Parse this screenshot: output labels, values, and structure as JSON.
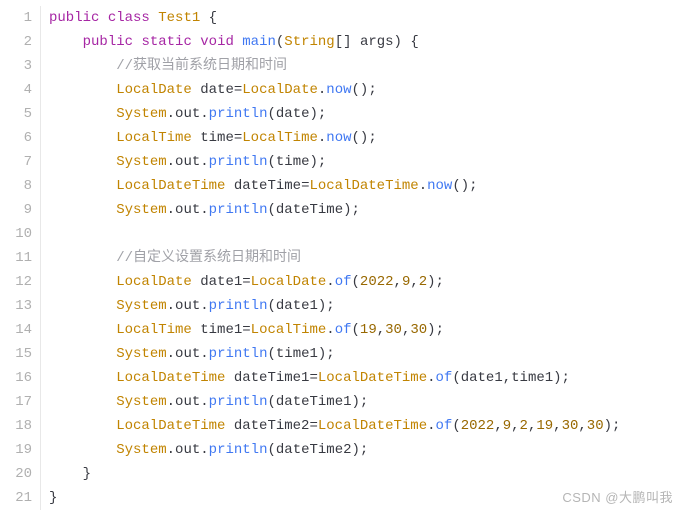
{
  "logical_content": {
    "description": "Java source code defining a class Test1 with a main method demonstrating java.time LocalDate/LocalTime/LocalDateTime usage.",
    "class_name": "Test1",
    "method": "public static void main(String[] args)",
    "comments": {
      "c1": "//获取当前系统日期和时间",
      "c2": "//自定义设置系统日期和时间"
    },
    "statements": [
      "LocalDate date=LocalDate.now();",
      "System.out.println(date);",
      "LocalTime time=LocalTime.now();",
      "System.out.println(time);",
      "LocalDateTime dateTime=LocalDateTime.now();",
      "System.out.println(dateTime);",
      "LocalDate date1=LocalDate.of(2022,9,2);",
      "System.out.println(date1);",
      "LocalTime time1=LocalTime.of(19,30,30);",
      "System.out.println(time1);",
      "LocalDateTime dateTime1=LocalDateTime.of(date1,time1);",
      "System.out.println(dateTime1);",
      "LocalDateTime dateTime2=LocalDateTime.of(2022,9,2,19,30,30);",
      "System.out.println(dateTime2);"
    ]
  },
  "gutter": [
    "1",
    "2",
    "3",
    "4",
    "5",
    "6",
    "7",
    "8",
    "9",
    "10",
    "11",
    "12",
    "13",
    "14",
    "15",
    "16",
    "17",
    "18",
    "19",
    "20",
    "21"
  ],
  "tokens": {
    "public": "public",
    "class": "class",
    "static": "static",
    "void": "void",
    "Test1": "Test1",
    "main": "main",
    "String": "String",
    "args": "args",
    "LocalDate": "LocalDate",
    "LocalTime": "LocalTime",
    "LocalDateTime": "LocalDateTime",
    "now": "now",
    "of": "of",
    "System": "System",
    "out": "out",
    "println": "println",
    "date": "date",
    "time": "time",
    "dateTime": "dateTime",
    "date1": "date1",
    "time1": "time1",
    "dateTime1": "dateTime1",
    "dateTime2": "dateTime2"
  },
  "nums": {
    "n2022": "2022",
    "n9": "9",
    "n2": "2",
    "n19": "19",
    "n30": "30"
  },
  "comments": {
    "c1": "//获取当前系统日期和时间",
    "c2": "//自定义设置系统日期和时间"
  },
  "punct": {
    "obrace": " {",
    "obrace2": ") {",
    "cbrace": "}",
    "op": "(",
    "cp": ")",
    "opcp_semi": "();",
    "cp_semi": ");",
    "semi": ";",
    "eq": "=",
    "dot": ".",
    "brackets": "[]",
    "comma": ",",
    "sp": " "
  },
  "indent": {
    "i1": "    ",
    "i2": "        ",
    "i3": "        "
  },
  "watermark": "CSDN @大鹏叫我"
}
